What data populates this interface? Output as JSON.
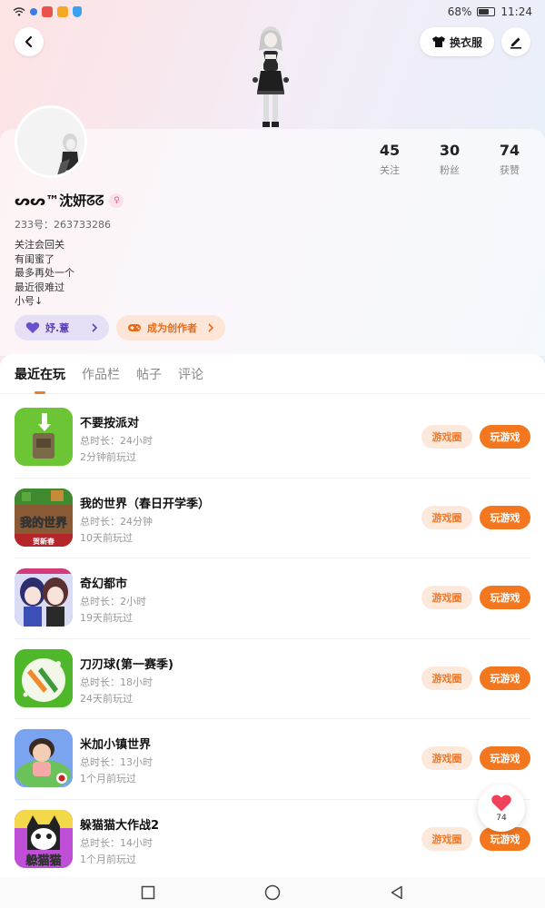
{
  "status_bar": {
    "battery": "68%",
    "battery_level": 0.68,
    "time": "11:24"
  },
  "header": {
    "outfit_label": "换衣服"
  },
  "profile": {
    "nickname": "ᔕᔕ™沈妍ᘔᘔ",
    "uid": "233号：263733286",
    "bio": [
      "关注会回关",
      "有闺蜜了",
      "最多再处一个",
      "最近很难过",
      "小号↓"
    ],
    "stats": [
      {
        "value": "45",
        "label": "关注"
      },
      {
        "value": "30",
        "label": "粉丝"
      },
      {
        "value": "74",
        "label": "获赞"
      }
    ],
    "chip_friend": "妤.薏",
    "chip_creator": "成为创作者"
  },
  "tabs": [
    "最近在玩",
    "作品栏",
    "帖子",
    "评论"
  ],
  "games": [
    {
      "title": "不要按派对",
      "duration": "总时长：24小时",
      "last_played": "2分钟前玩过",
      "icon": "green-button-game-icon",
      "icon_color": "#5fbf2a"
    },
    {
      "title": "我的世界（春日开学季）",
      "duration": "总时长：24分钟",
      "last_played": "10天前玩过",
      "icon": "minecraft-icon",
      "icon_color": "#7a5130",
      "icon_text": "我的世界",
      "icon_subtext": "贺新春"
    },
    {
      "title": "奇幻都市",
      "duration": "总时长：2小时",
      "last_played": "19天前玩过",
      "icon": "anime-characters-icon",
      "icon_color": "#7b5fd8"
    },
    {
      "title": "刀刃球(第一赛季)",
      "duration": "总时长：18小时",
      "last_played": "24天前玩过",
      "icon": "blade-ball-icon",
      "icon_color": "#4fb82a"
    },
    {
      "title": "米加小镇世界",
      "duration": "总时长：13小时",
      "last_played": "1个月前玩过",
      "icon": "miga-town-icon",
      "icon_color": "#6a86e8"
    },
    {
      "title": "躲猫猫大作战2",
      "duration": "总时长：14小时",
      "last_played": "1个月前玩过",
      "icon": "cat-hide-icon",
      "icon_color": "#c04fd8",
      "icon_text": "躲猫猫"
    }
  ],
  "buttons": {
    "circle": "游戏圈",
    "play": "玩游戏"
  },
  "like_float": {
    "count": "74"
  },
  "colors": {
    "accent": "#f2771f",
    "accent_soft": "#fde9dc",
    "purple_chip": "#e6e0f6"
  }
}
